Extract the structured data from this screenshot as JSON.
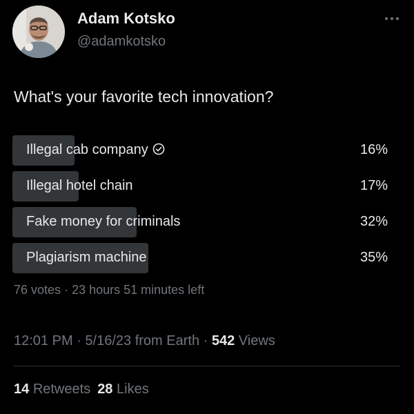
{
  "author": {
    "name": "Adam Kotsko",
    "handle": "@adamkotsko",
    "avatar_icon": "profile-photo",
    "more_icon": "more-horizontal-icon"
  },
  "tweet": {
    "question": "What's your favorite tech innovation?"
  },
  "poll": {
    "options": [
      {
        "label": "Illegal cab company",
        "percent_text": "16%",
        "percent": 16,
        "selected": true
      },
      {
        "label": "Illegal hotel chain",
        "percent_text": "17%",
        "percent": 17,
        "selected": false
      },
      {
        "label": "Fake money for criminals",
        "percent_text": "32%",
        "percent": 32,
        "selected": false
      },
      {
        "label": "Plagiarism machine",
        "percent_text": "35%",
        "percent": 35,
        "selected": false
      }
    ],
    "votes": "76 votes",
    "separator": "·",
    "time_left": "23 hours 51 minutes left"
  },
  "meta": {
    "time": "12:01 PM",
    "date": "5/16/23",
    "source": "from Earth",
    "separator": "·",
    "views_count": "542",
    "views_label": "Views"
  },
  "engagement": {
    "retweets_count": "14",
    "retweets_label": "Retweets",
    "likes_count": "28",
    "likes_label": "Likes"
  },
  "colors": {
    "background": "#000000",
    "text_primary": "#e7e9ea",
    "text_secondary": "#71767b",
    "poll_bar": "#333639",
    "divider": "#2f3336"
  }
}
